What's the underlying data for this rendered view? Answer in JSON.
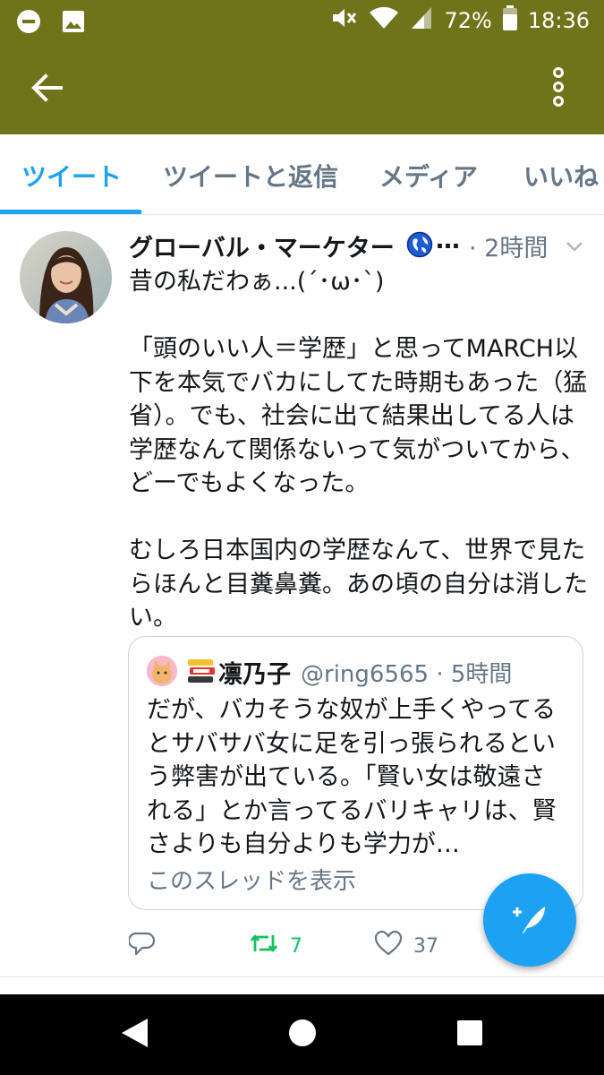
{
  "status_bar": {
    "battery": "72%",
    "time": "18:36",
    "icons": [
      "minus-circle-icon",
      "image-icon",
      "mute-icon",
      "wifi-icon",
      "signal-icon",
      "battery-icon"
    ]
  },
  "app_bar": {
    "back_icon": "arrow-left-icon",
    "more_icon": "more-vertical-icon",
    "color": "#6f7319"
  },
  "tabs": [
    {
      "label": "ツイート",
      "active": true
    },
    {
      "label": "ツイートと返信",
      "active": false
    },
    {
      "label": "メディア",
      "active": false
    },
    {
      "label": "いいね",
      "active": false
    }
  ],
  "tweet": {
    "display_name": "グローバル・マーケター",
    "name_overflow": "…",
    "time": "· 2時間",
    "text": "昔の私だわぁ...(´･ω･`)\n\n「頭のいい人＝学歴」と思ってMARCH以下を本気でバカにしてた時期もあった（猛省）。でも、社会に出て結果出してる人は学歴なんて関係ないって気がついてから、どーでもよくなった。\n\nむしろ日本国内の学歴なんて、世界で見たらほんと目糞鼻糞。あの頃の自分は消したい。",
    "quote": {
      "name": "凛乃子",
      "handle_time": "@ring6565 · 5時間",
      "text": "だが、バカそうな奴が上手くやってるとサバサバ女に足を引っ張られるという弊害が出ている。「賢い女は敬遠される」とか言ってるバリキャリは、賢さよりも自分よりも学力が…",
      "show_thread": "このスレッドを表示"
    },
    "actions": {
      "reply_count": "",
      "retweet_count": "7",
      "like_count": "37"
    }
  },
  "colors": {
    "accent": "#1da1f2",
    "retweet": "#17bf63",
    "muted": "#657786"
  }
}
